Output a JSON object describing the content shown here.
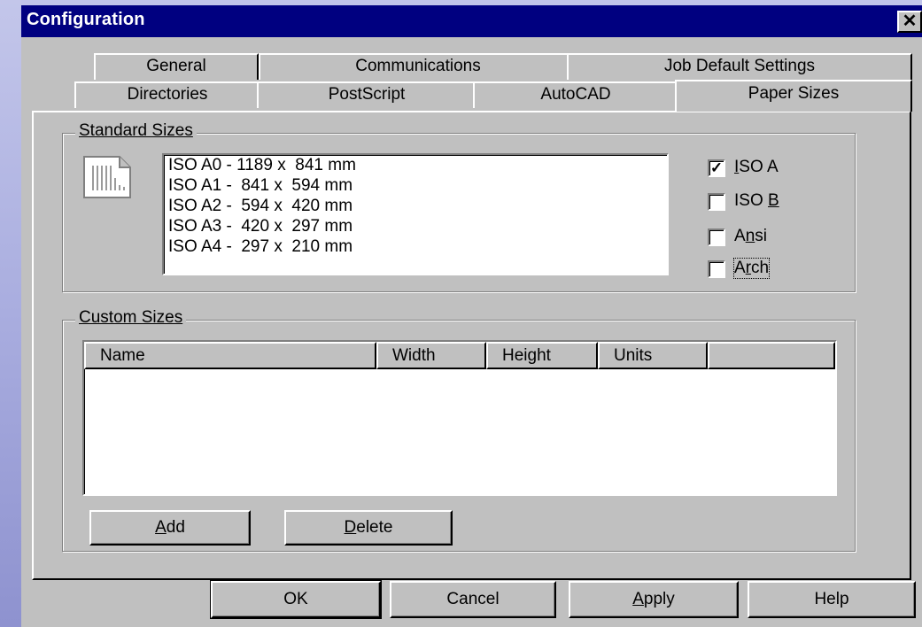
{
  "window": {
    "title": "Configuration",
    "close_glyph": "✕"
  },
  "tabs": {
    "row_back": [
      "General",
      "Communications",
      "Job Default Settings"
    ],
    "row_front": [
      "Directories",
      "PostScript",
      "AutoCAD",
      "Paper Sizes"
    ],
    "active": "Paper Sizes"
  },
  "standard_sizes": {
    "label": "Standard Sizes",
    "icon": "paper-icon",
    "items": [
      "ISO A0 - 1189 x  841 mm",
      "ISO A1 -  841 x  594 mm",
      "ISO A2 -  594 x  420 mm",
      "ISO A3 -  420 x  297 mm",
      "ISO A4 -  297 x  210 mm"
    ],
    "checkboxes": [
      {
        "label": "ISO A",
        "checked": true
      },
      {
        "label": "ISO B",
        "checked": false
      },
      {
        "label": "Ansi",
        "checked": false
      },
      {
        "label": "Arch",
        "checked": false
      }
    ]
  },
  "custom_sizes": {
    "label": "Custom Sizes",
    "columns": [
      "Name",
      "Width",
      "Height",
      "Units"
    ],
    "rows": [],
    "add_label": "Add",
    "delete_label": "Delete"
  },
  "footer": {
    "ok_label": "OK",
    "cancel_label": "Cancel",
    "apply_label": "Apply",
    "help_label": "Help"
  },
  "colors": {
    "titlebar": "#000080",
    "face": "#c0c0c0",
    "list_bg": "#ffffff"
  }
}
